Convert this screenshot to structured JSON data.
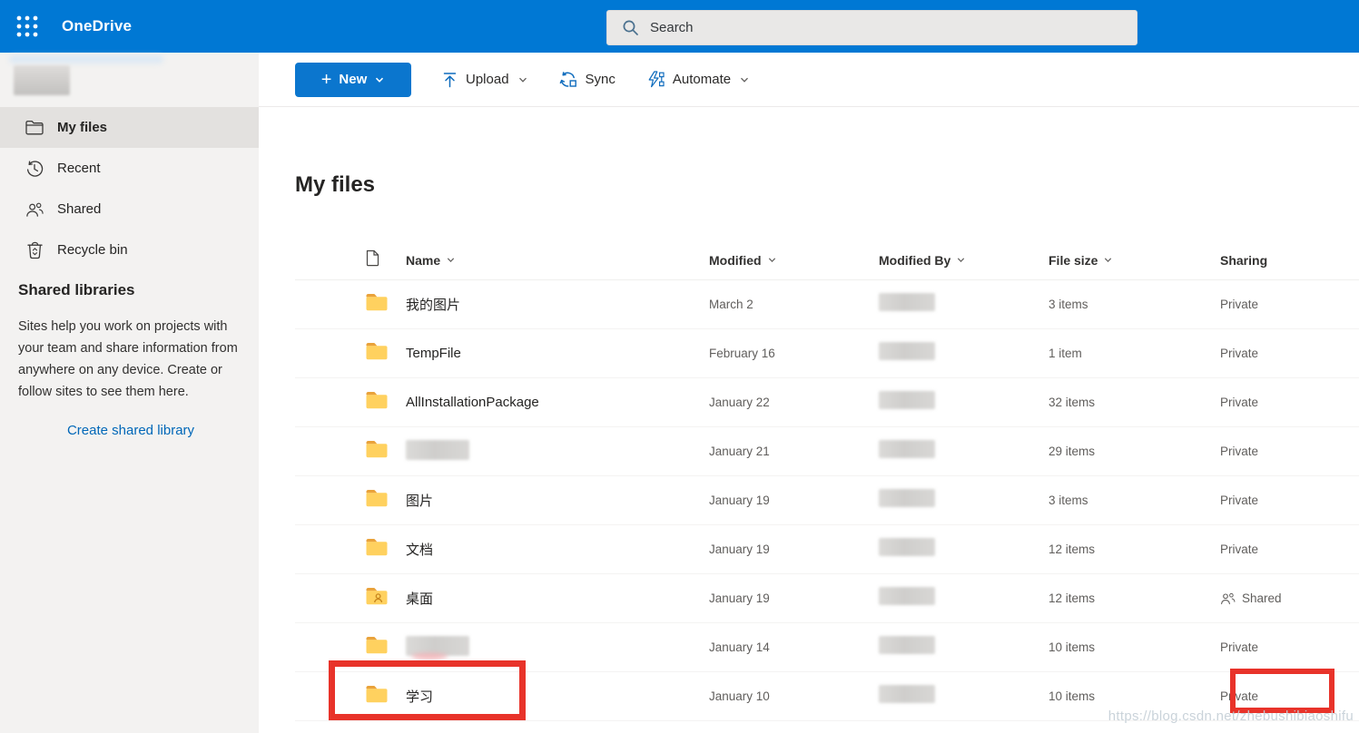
{
  "app": {
    "title": "OneDrive"
  },
  "topbar": {
    "search_placeholder": "Search"
  },
  "toolbar": {
    "new_label": "New",
    "upload_label": "Upload",
    "sync_label": "Sync",
    "automate_label": "Automate"
  },
  "sidebar": {
    "items": [
      {
        "label": "My files",
        "icon": "folder-icon",
        "selected": true
      },
      {
        "label": "Recent",
        "icon": "history-icon",
        "selected": false
      },
      {
        "label": "Shared",
        "icon": "people-icon",
        "selected": false
      },
      {
        "label": "Recycle bin",
        "icon": "trash-icon",
        "selected": false
      }
    ],
    "shared_libraries": {
      "heading": "Shared libraries",
      "description": "Sites help you work on projects with your team and share information from anywhere on any device. Create or follow sites to see them here.",
      "link_label": "Create shared library"
    }
  },
  "main": {
    "title": "My files",
    "table": {
      "columns": [
        "Name",
        "Modified",
        "Modified By",
        "File size",
        "Sharing"
      ],
      "rows": [
        {
          "name": "我的图片",
          "name_redacted": false,
          "modified": "March 2",
          "modified_by_redacted": true,
          "size": "3 items",
          "sharing": "Private",
          "shared_folder": false,
          "highlighted": false
        },
        {
          "name": "TempFile",
          "name_redacted": false,
          "modified": "February 16",
          "modified_by_redacted": true,
          "size": "1 item",
          "sharing": "Private",
          "shared_folder": false,
          "highlighted": false
        },
        {
          "name": "AllInstallationPackage",
          "name_redacted": false,
          "modified": "January 22",
          "modified_by_redacted": true,
          "size": "32 items",
          "sharing": "Private",
          "shared_folder": false,
          "highlighted": false
        },
        {
          "name": "",
          "name_redacted": true,
          "modified": "January 21",
          "modified_by_redacted": true,
          "size": "29 items",
          "sharing": "Private",
          "shared_folder": false,
          "highlighted": false
        },
        {
          "name": "图片",
          "name_redacted": false,
          "modified": "January 19",
          "modified_by_redacted": true,
          "size": "3 items",
          "sharing": "Private",
          "shared_folder": false,
          "highlighted": false
        },
        {
          "name": "文档",
          "name_redacted": false,
          "modified": "January 19",
          "modified_by_redacted": true,
          "size": "12 items",
          "sharing": "Private",
          "shared_folder": false,
          "highlighted": false
        },
        {
          "name": "桌面",
          "name_redacted": false,
          "modified": "January 19",
          "modified_by_redacted": true,
          "size": "12 items",
          "sharing": "Shared",
          "shared_folder": true,
          "highlighted": false
        },
        {
          "name": "",
          "name_redacted": true,
          "redact_tint": "pink",
          "modified": "January 14",
          "modified_by_redacted": true,
          "size": "10 items",
          "sharing": "Private",
          "shared_folder": false,
          "highlighted": false
        },
        {
          "name": "学习",
          "name_redacted": false,
          "modified": "January 10",
          "modified_by_redacted": true,
          "size": "10 items",
          "sharing": "Private",
          "shared_folder": false,
          "highlighted": true
        }
      ]
    }
  },
  "annotations": {
    "highlight_color": "#e8332a"
  },
  "watermark": "https://blog.csdn.net/zhebushibiaoshifu",
  "colors": {
    "accent": "#0078d4",
    "sidebar_bg": "#f3f2f1",
    "selected_bg": "#e3e1df",
    "link": "#0067b8",
    "folder_tab": "#e9a23b",
    "folder_body": "#ffd15f",
    "icon_blue": "#0f6cbd",
    "text_dark": "#252423",
    "text_dim": "#605e5c"
  }
}
